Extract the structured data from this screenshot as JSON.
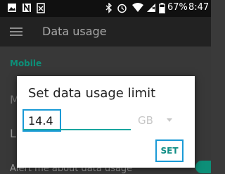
{
  "status_bar": {
    "battery_percent": "67%",
    "time": "8:47",
    "icons": [
      "image-icon",
      "n-notification-icon",
      "document-icon",
      "bluetooth-icon",
      "alarm-icon",
      "wifi-icon",
      "signal-off-icon",
      "battery-icon"
    ]
  },
  "app_bar": {
    "title": "Data usage",
    "menu_icon": "menu-icon"
  },
  "content": {
    "section_header": "Mobile",
    "row_m_partial": "M",
    "row_l_partial": "L",
    "row_alert_partial": "Alert me about data usage"
  },
  "dialog": {
    "title": "Set data usage limit",
    "value": "14.4",
    "unit": "GB",
    "button": "SET"
  },
  "colors": {
    "accent": "#0d8f78",
    "highlight_box": "#1a9ad6",
    "dialog_bg": "#ffffff"
  }
}
